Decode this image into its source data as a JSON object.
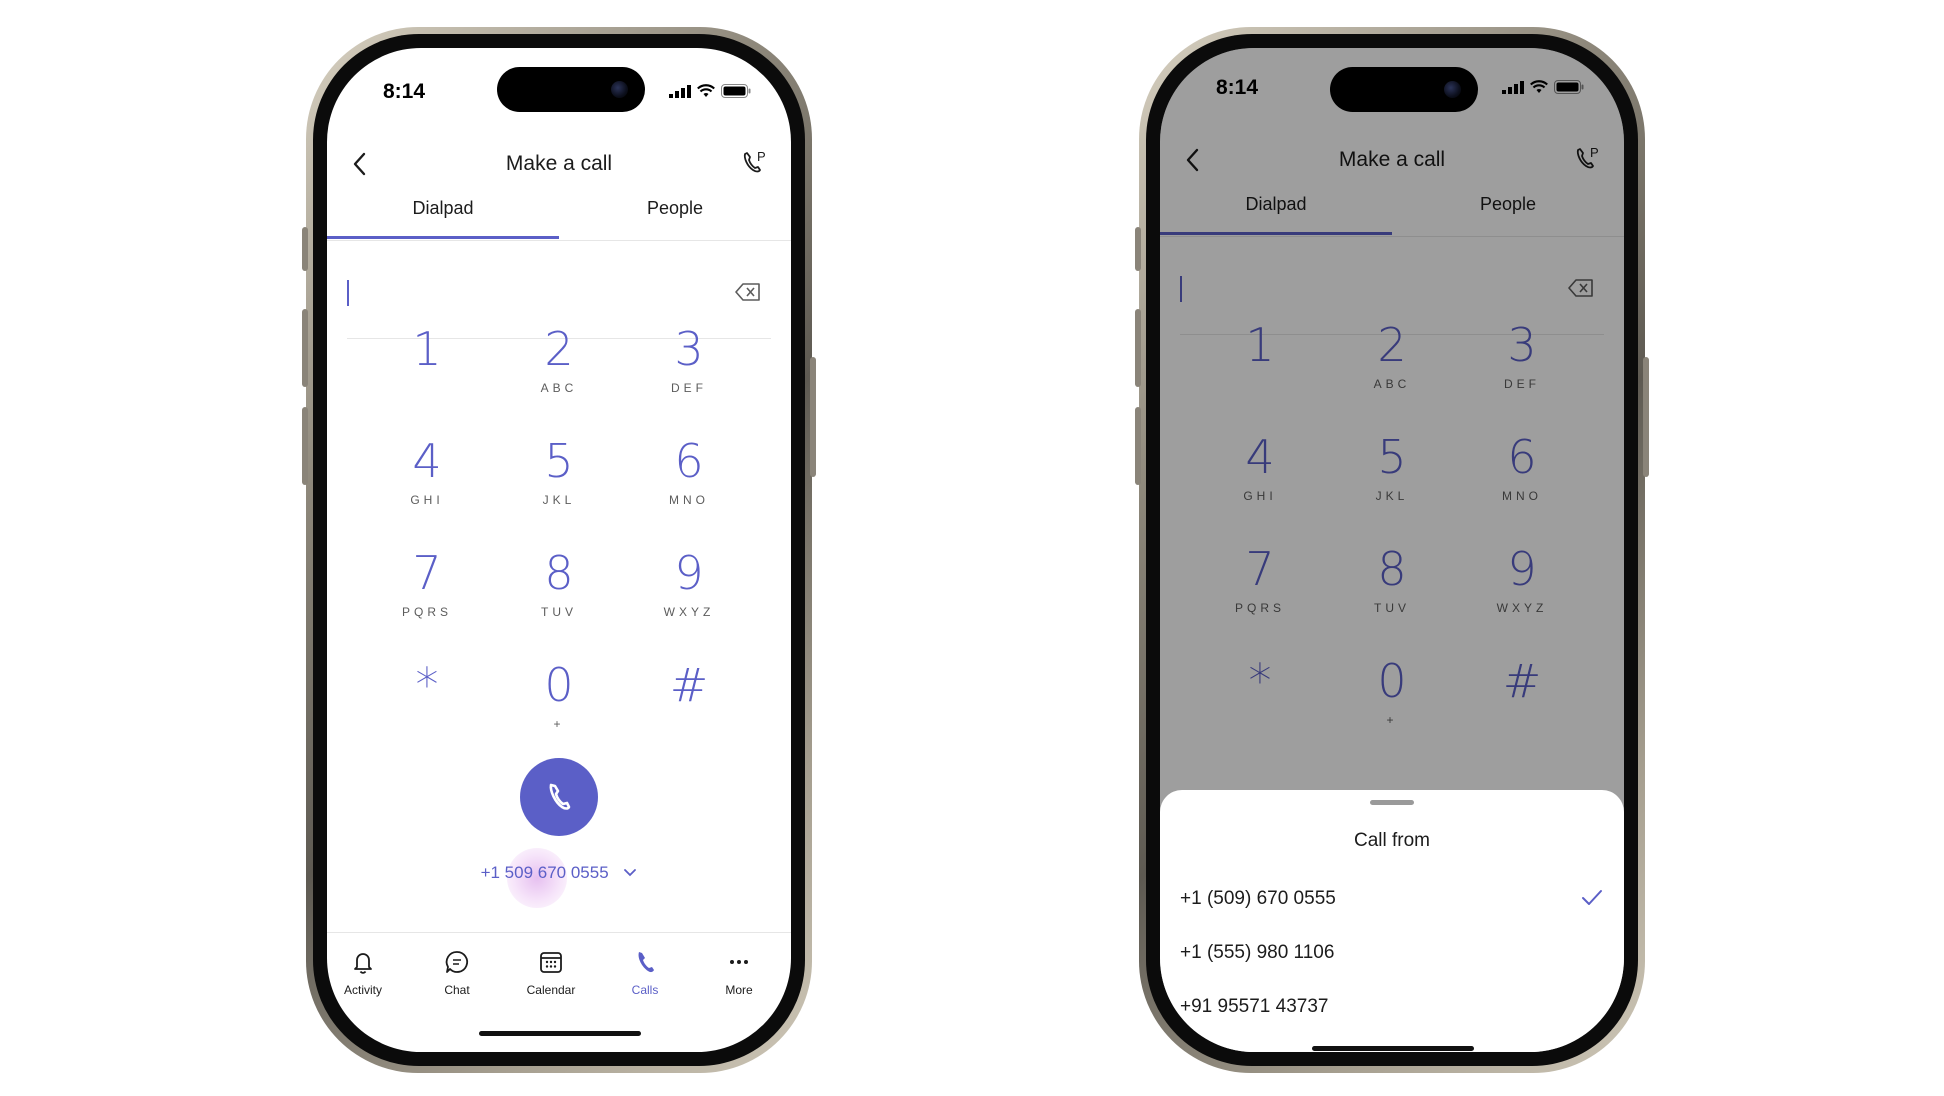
{
  "left_phone": {
    "status": {
      "time": "8:14"
    },
    "header": {
      "title": "Make a call"
    },
    "tabs": [
      {
        "label": "Dialpad"
      },
      {
        "label": "People"
      }
    ],
    "keys": [
      {
        "digit": "1",
        "letters": ""
      },
      {
        "digit": "2",
        "letters": "ABC"
      },
      {
        "digit": "3",
        "letters": "DEF"
      },
      {
        "digit": "4",
        "letters": "GHI"
      },
      {
        "digit": "5",
        "letters": "JKL"
      },
      {
        "digit": "6",
        "letters": "MNO"
      },
      {
        "digit": "7",
        "letters": "PQRS"
      },
      {
        "digit": "8",
        "letters": "TUV"
      },
      {
        "digit": "9",
        "letters": "WXYZ"
      },
      {
        "digit": "*",
        "letters": ""
      },
      {
        "digit": "0",
        "letters": "+"
      },
      {
        "digit": "#",
        "letters": ""
      }
    ],
    "caller_id": "+1 509 670 0555",
    "tabbar": [
      {
        "label": "Activity",
        "icon": "bell-icon"
      },
      {
        "label": "Chat",
        "icon": "chat-icon"
      },
      {
        "label": "Calendar",
        "icon": "calendar-icon"
      },
      {
        "label": "Calls",
        "icon": "phone-icon"
      },
      {
        "label": "More",
        "icon": "more-icon"
      }
    ]
  },
  "right_phone": {
    "status": {
      "time": "8:14"
    },
    "header": {
      "title": "Make a call"
    },
    "tabs": [
      {
        "label": "Dialpad"
      },
      {
        "label": "People"
      }
    ],
    "keys": [
      {
        "digit": "1",
        "letters": ""
      },
      {
        "digit": "2",
        "letters": "ABC"
      },
      {
        "digit": "3",
        "letters": "DEF"
      },
      {
        "digit": "4",
        "letters": "GHI"
      },
      {
        "digit": "5",
        "letters": "JKL"
      },
      {
        "digit": "6",
        "letters": "MNO"
      },
      {
        "digit": "7",
        "letters": "PQRS"
      },
      {
        "digit": "8",
        "letters": "TUV"
      },
      {
        "digit": "9",
        "letters": "WXYZ"
      },
      {
        "digit": "*",
        "letters": ""
      },
      {
        "digit": "0",
        "letters": "+"
      },
      {
        "digit": "#",
        "letters": ""
      }
    ],
    "sheet": {
      "title": "Call from",
      "options": [
        {
          "number": "+1 (509) 670 0555",
          "selected": true
        },
        {
          "number": "+1 (555) 980 1106",
          "selected": false
        },
        {
          "number": "+91 95571 43737",
          "selected": false
        }
      ]
    }
  },
  "colors": {
    "accent": "#5b5fc7",
    "text": "#1c1c1c",
    "subtext": "#5c5c5c",
    "divider": "#e6e6e6"
  }
}
